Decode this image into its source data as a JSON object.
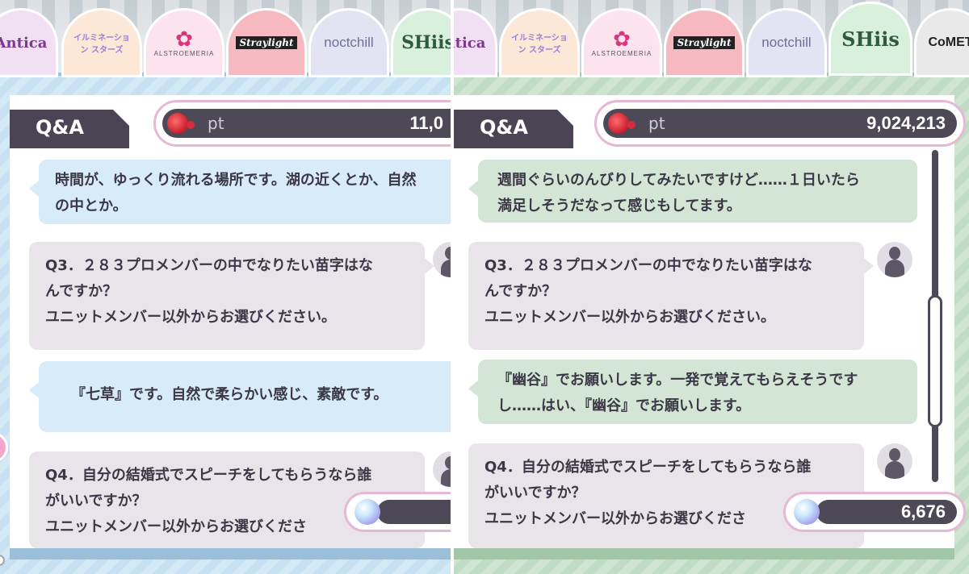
{
  "left": {
    "tabs": [
      {
        "id": "antica",
        "label": "Antica",
        "color": "#7b3a8f",
        "bg": "#f1dff3"
      },
      {
        "id": "illumination",
        "label": "イルミネーション スターズ",
        "color": "#9a7fd0",
        "bg": "#fde7d6"
      },
      {
        "id": "alstroemeria",
        "label": "ALSTROEMERIA",
        "color": "#e0337d",
        "bg": "#fce3ee"
      },
      {
        "id": "straylight",
        "label": "Straylight",
        "color": "#222222",
        "bg": "#f6b9bf"
      },
      {
        "id": "noctchill",
        "label": "noctchill",
        "color": "#6b6f9c",
        "bg": "#e3e3f3"
      },
      {
        "id": "shhis",
        "label": "SHiis",
        "color": "#2f5a3b",
        "bg": "#d8f0dc"
      }
    ],
    "header": {
      "qa_label": "Q&A",
      "pt_label": "pt",
      "pt_value": "11,0"
    },
    "messages": {
      "a1_line1": "時間が、ゆっくり流れる場所です。湖の近くとか、自然",
      "a1_line2": "の中とか。",
      "q3_line1": "Q3．２８３プロメンバーの中でなりたい苗字はな",
      "q3_line2": "んですか？",
      "q3_line3": "ユニットメンバー以外からお選びください。",
      "a3_line1": "『七草』です。自然で柔らかい感じ、素敵です。",
      "q4_line1": "Q4．自分の結婚式でスピーチをしてもらうなら誰",
      "q4_line2": "がいいですか？",
      "q4_line3": "ユニットメンバー以外からお選びくださ"
    },
    "bottom_value": ""
  },
  "right": {
    "tabs": [
      {
        "id": "antica",
        "label": "Antica",
        "color": "#7b3a8f",
        "bg": "#f1dff3"
      },
      {
        "id": "illumination",
        "label": "イルミネーション スターズ",
        "color": "#9a7fd0",
        "bg": "#fde7d6"
      },
      {
        "id": "alstroemeria",
        "label": "ALSTROEMERIA",
        "color": "#e0337d",
        "bg": "#fce3ee"
      },
      {
        "id": "straylight",
        "label": "Straylight",
        "color": "#222222",
        "bg": "#f6b9bf"
      },
      {
        "id": "noctchill",
        "label": "noctchill",
        "color": "#6b6f9c",
        "bg": "#e3e3f3"
      },
      {
        "id": "shhis",
        "label": "SHiis",
        "color": "#2f5a3b",
        "bg": "#d8f0dc"
      },
      {
        "id": "comet",
        "label": "CoMET",
        "color": "#222222",
        "bg": "#e9e9e9"
      }
    ],
    "header": {
      "qa_label": "Q&A",
      "pt_label": "pt",
      "pt_value": "9,024,213"
    },
    "messages": {
      "a2_line1": "週間ぐらいのんびりしてみたいですけど……１日いたら",
      "a2_line2": "満足しそうだなって感じもしてます。",
      "q3_line1": "Q3．２８３プロメンバーの中でなりたい苗字はな",
      "q3_line2": "んですか？",
      "q3_line3": "ユニットメンバー以外からお選びください。",
      "a3_line1": "『幽谷』でお願いします。一発で覚えてもらえそうです",
      "a3_line2": "し……はい、『幽谷』でお願いします。",
      "q4_line1": "Q4．自分の結婚式でスピーチをしてもらうなら誰",
      "q4_line2": "がいいですか？",
      "q4_line3": "ユニットメンバー以外からお選びくださ"
    },
    "bottom_value": "6,676"
  },
  "icons": {
    "pt_icon": "rose-pt-icon",
    "bottom_icon": "crystal-gem-icon",
    "avatar": "producer-silhouette-avatar"
  }
}
